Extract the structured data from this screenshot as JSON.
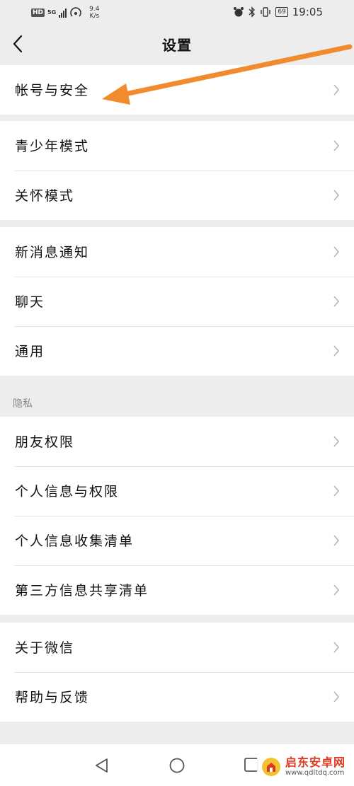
{
  "status_bar": {
    "hd": "HD",
    "network": "5G",
    "speed_value": "9.4",
    "speed_unit": "K/s",
    "battery": "69",
    "time": "19:05"
  },
  "header": {
    "title": "设置"
  },
  "groups": [
    {
      "items": [
        {
          "label": "帐号与安全"
        }
      ]
    },
    {
      "items": [
        {
          "label": "青少年模式"
        },
        {
          "label": "关怀模式"
        }
      ]
    },
    {
      "items": [
        {
          "label": "新消息通知"
        },
        {
          "label": "聊天"
        },
        {
          "label": "通用"
        }
      ]
    },
    {
      "section_title": "隐私",
      "items": [
        {
          "label": "朋友权限"
        },
        {
          "label": "个人信息与权限"
        },
        {
          "label": "个人信息收集清单"
        },
        {
          "label": "第三方信息共享清单"
        }
      ]
    },
    {
      "items": [
        {
          "label": "关于微信"
        },
        {
          "label": "帮助与反馈"
        }
      ]
    }
  ],
  "watermark": {
    "title": "启东安卓网",
    "url": "www.qdltdq.com"
  },
  "colors": {
    "arrow": "#f28a2e",
    "background": "#ededed",
    "watermark_red": "#e0371f"
  }
}
